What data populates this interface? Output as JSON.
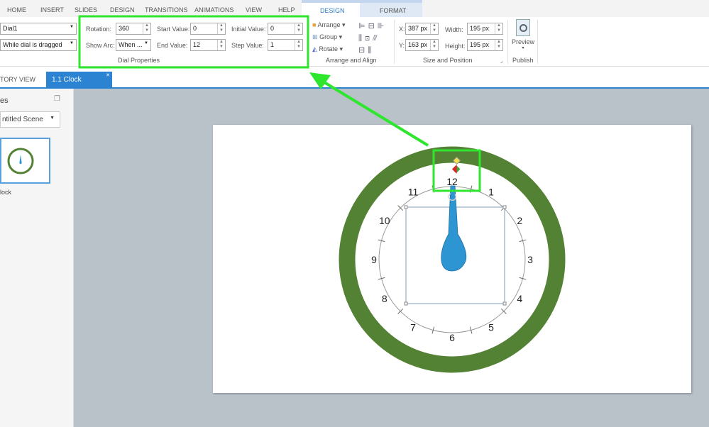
{
  "menu": {
    "tabs": [
      "HOME",
      "INSERT",
      "SLIDES",
      "DESIGN",
      "TRANSITIONS",
      "ANIMATIONS",
      "VIEW",
      "HELP"
    ],
    "context_tabs": [
      "DESIGN",
      "FORMAT"
    ]
  },
  "ribbon": {
    "object_name": "Dial1",
    "interaction": "While dial is dragged",
    "dial": {
      "rotation_label": "Rotation:",
      "rotation": "360",
      "start_label": "Start Value:",
      "start": "0",
      "initial_label": "Initial Value:",
      "initial": "0",
      "arc_label": "Show Arc:",
      "arc": "When ...",
      "end_label": "End Value:",
      "end": "12",
      "step_label": "Step Value:",
      "step": "1",
      "group": "Dial Properties"
    },
    "arrange": {
      "arrange": "Arrange",
      "group_btn": "Group",
      "rotate": "Rotate",
      "group": "Arrange and Align"
    },
    "size": {
      "x_label": "X:",
      "x": "387 px",
      "y_label": "Y:",
      "y": "163 px",
      "w_label": "Width:",
      "w": "195 px",
      "h_label": "Height:",
      "h": "195 px",
      "group": "Size and Position"
    },
    "publish": {
      "preview": "Preview",
      "group": "Publish"
    }
  },
  "doc_tabs": {
    "story": "TORY VIEW",
    "active": "1.1 Clock"
  },
  "scenes": {
    "title": "es",
    "scene": "ntitled Scene",
    "slide_label": "lock"
  },
  "clock": {
    "numbers": [
      "12",
      "1",
      "2",
      "3",
      "4",
      "5",
      "6",
      "7",
      "8",
      "9",
      "10",
      "11"
    ],
    "ring_color": "#548235",
    "hand_color": "#2e95d3"
  }
}
